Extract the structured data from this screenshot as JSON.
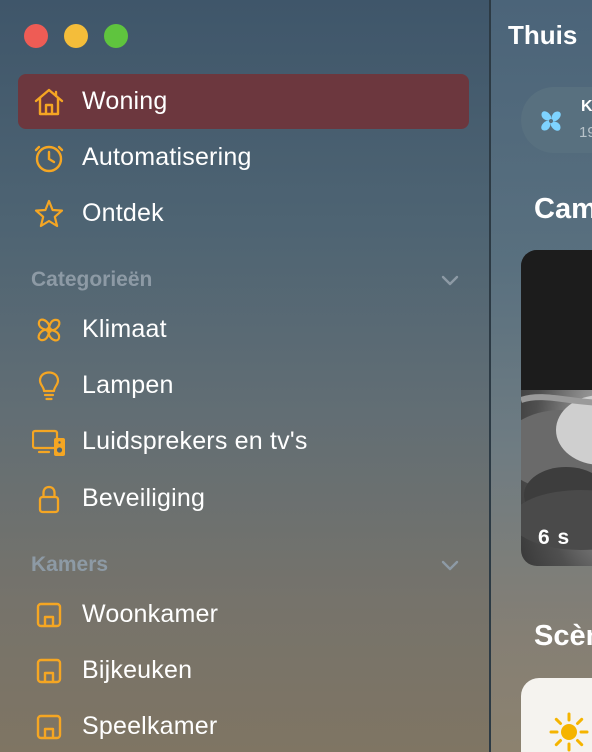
{
  "window": {
    "title": "Thuis"
  },
  "sidebar": {
    "items": [
      {
        "label": "Woning",
        "icon": "house-icon",
        "selected": true
      },
      {
        "label": "Automatisering",
        "icon": "clock-icon"
      },
      {
        "label": "Ontdek",
        "icon": "star-icon"
      }
    ],
    "categories": {
      "heading": "Categorieën",
      "items": [
        {
          "label": "Klimaat",
          "icon": "fan-icon"
        },
        {
          "label": "Lampen",
          "icon": "lightbulb-icon"
        },
        {
          "label": "Luidsprekers en tv's",
          "icon": "tv-speaker-icon"
        },
        {
          "label": "Beveiliging",
          "icon": "lock-icon"
        }
      ]
    },
    "rooms": {
      "heading": "Kamers",
      "items": [
        {
          "label": "Woonkamer",
          "icon": "room-icon"
        },
        {
          "label": "Bijkeuken",
          "icon": "room-icon"
        },
        {
          "label": "Speelkamer",
          "icon": "room-icon"
        }
      ]
    }
  },
  "main": {
    "status_pill": {
      "title": "K",
      "subtitle": "19",
      "icon": "fan-icon"
    },
    "cameras_heading": "Cam",
    "camera_time": "6 s",
    "scenes_heading": "Scèn",
    "scene_icon": "sun-icon"
  },
  "colors": {
    "accent": "#f5a623",
    "selected_bg": "#6c373e",
    "section_text": "#8d9aa5"
  }
}
